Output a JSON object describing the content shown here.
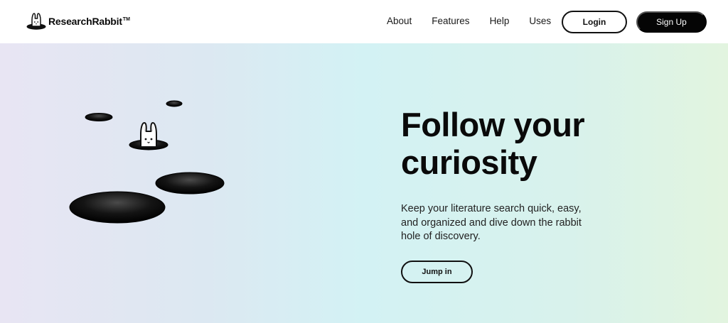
{
  "brand": {
    "name": "ResearchRabbit",
    "trademark": "TM",
    "logo_icon": "rabbit-in-hole-icon"
  },
  "nav": {
    "links": [
      {
        "label": "About"
      },
      {
        "label": "Features"
      },
      {
        "label": "Help"
      },
      {
        "label": "Uses"
      }
    ],
    "login_label": "Login",
    "signup_label": "Sign Up"
  },
  "hero": {
    "headline_line1": "Follow your",
    "headline_line2": "curiosity",
    "description": "Keep your literature search quick, easy, and organized and dive down the rabbit hole of discovery.",
    "cta_label": "Jump in",
    "illustration_icon": "rabbit-holes-illustration"
  },
  "colors": {
    "ink": "#0b0b0b",
    "hero_gradient": [
      "#e8e5f3",
      "#d3f2f4",
      "#e2f4df"
    ]
  }
}
